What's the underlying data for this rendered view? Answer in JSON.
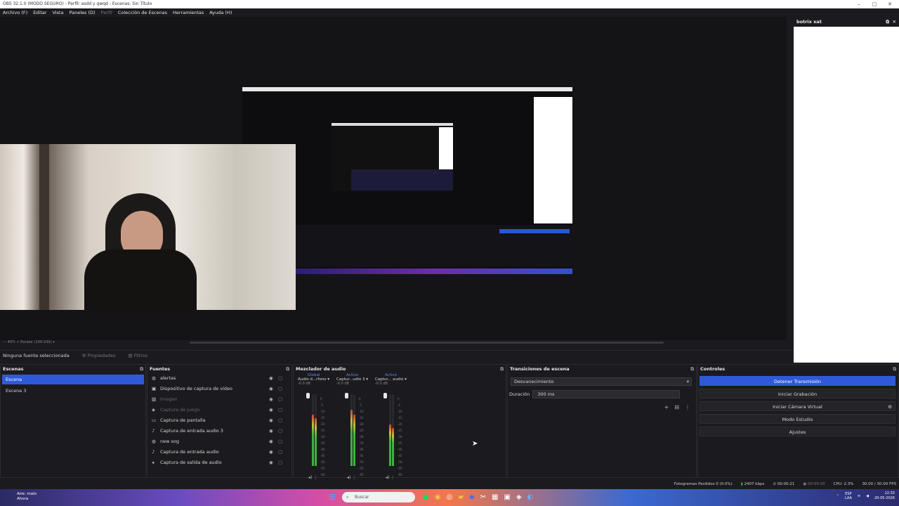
{
  "window": {
    "title": "OBS 32.1.0 (MODO SEGURO) - Perfil: asdd y qwqd - Escenas: Sin Título"
  },
  "menu": [
    "Archivo (F)",
    "Editar",
    "Vista",
    "Paneles (D)",
    "Perfil",
    "Colección de Escenas",
    "Herramientas",
    "Ayuda (H)"
  ],
  "preview_footer": "— 40% + Escalar (100:100) ▾",
  "side_panel": {
    "title": "botrix xat"
  },
  "context_bar": {
    "no_source": "Ninguna fuente seleccionada",
    "properties": "Propiedades",
    "filters": "Filtros"
  },
  "scenes": {
    "title": "Escenas",
    "items": [
      "Escena",
      "Escena 3"
    ],
    "selected": "Escena"
  },
  "sources": {
    "title": "Fuentes",
    "items": [
      {
        "label": "alertas",
        "icon": "browser-icon",
        "dim": false
      },
      {
        "label": "Dispositivo de captura de vídeo",
        "icon": "camera-icon",
        "dim": false
      },
      {
        "label": "Imagen",
        "icon": "image-icon",
        "dim": true
      },
      {
        "label": "Captura de juego",
        "icon": "gamepad-icon",
        "dim": true
      },
      {
        "label": "Captura de pantalla",
        "icon": "monitor-icon",
        "dim": false
      },
      {
        "label": "Captura de entrada audio 3",
        "icon": "mic-icon",
        "dim": false
      },
      {
        "label": "new sog",
        "icon": "browser-icon",
        "dim": false
      },
      {
        "label": "Captura de entrada audio",
        "icon": "mic-icon",
        "dim": false
      },
      {
        "label": "Captura de salida de audio",
        "icon": "speaker-icon",
        "dim": false
      }
    ]
  },
  "mixer": {
    "title": "Mezclador de audio",
    "channels": [
      {
        "tag": "Global",
        "name": "Audio d...rfono ▾",
        "db": "-0.0 dB",
        "level": 0.72
      },
      {
        "tag": "Activo",
        "name": "Captur...udio 3 ▾",
        "db": "-0.0 dB",
        "level": 0.78
      },
      {
        "tag": "Activo",
        "name": "Captur... audio ▾",
        "db": "-0.0 dB",
        "level": 0.58
      }
    ],
    "scale": [
      "0",
      "-5",
      "-10",
      "-15",
      "-20",
      "-25",
      "-30",
      "-35",
      "-40",
      "-45",
      "-50",
      "-55",
      "-60"
    ]
  },
  "transitions": {
    "title": "Transiciones de escena",
    "selected": "Desvanecimiento",
    "duration_label": "Duración",
    "duration_value": "300 ms"
  },
  "controls": {
    "title": "Controles",
    "buttons": [
      "Detener Transmisión",
      "Iniciar Grabación",
      "Iniciar Cámara Virtual",
      "Modo Estudio",
      "Ajustes"
    ]
  },
  "status": {
    "frames": "Fotogramas Perdidos 0 (0.0%)",
    "bitrate": "2407 kbps",
    "stream_time": "00:00:21",
    "rec_time": "00:00:00",
    "cpu": "CPU: 2.3%",
    "fps": "30.00 / 30.00 FPS"
  },
  "taskbar": {
    "weather_top": "Aire: malo",
    "weather_bottom": "Ahora",
    "search_placeholder": "Buscar",
    "lang": "ESP",
    "lang2": "LAA",
    "time": "22:33",
    "date": "20-05-2026"
  }
}
